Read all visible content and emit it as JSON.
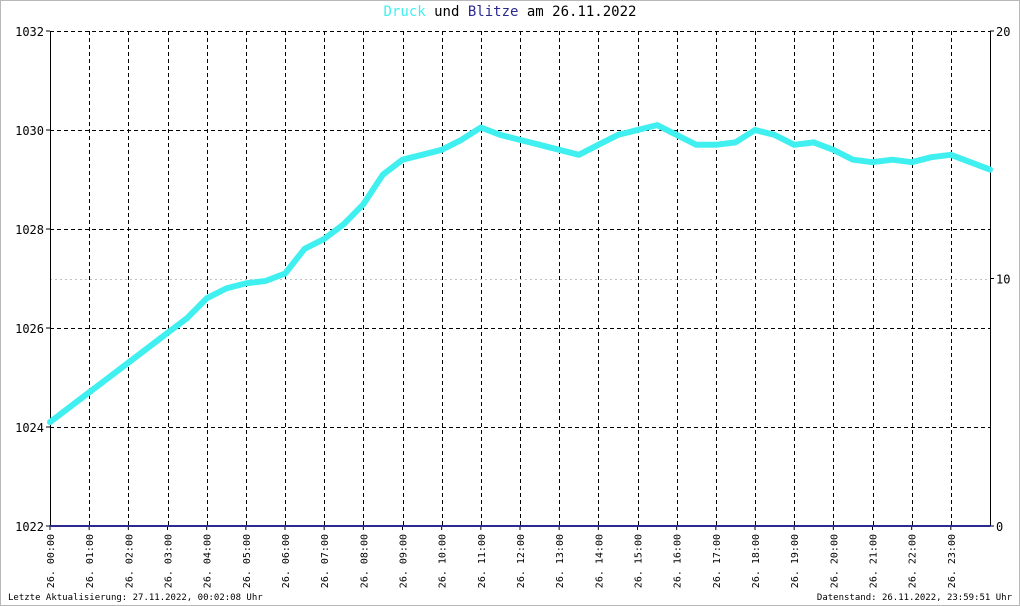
{
  "title": {
    "part1": "Druck",
    "part2": " und ",
    "part3": "Blitze",
    "part4": " am 26.11.2022"
  },
  "colors": {
    "pressure": "#40f0f0",
    "lightning": "#2a2a90",
    "grid": "#000000",
    "axis": "#000000",
    "text": "#000000"
  },
  "footer": {
    "left": "Letzte Aktualisierung: 27.11.2022, 00:02:08 Uhr",
    "right": "Datenstand: 26.11.2022, 23:59:51 Uhr"
  },
  "chart_data": {
    "type": "line",
    "title": "Druck und Blitze am 26.11.2022",
    "x_tick_labels": [
      "26. 00:00",
      "26. 01:00",
      "26. 02:00",
      "26. 03:00",
      "26. 04:00",
      "26. 05:00",
      "26. 06:00",
      "26. 07:00",
      "26. 08:00",
      "26. 09:00",
      "26. 10:00",
      "26. 11:00",
      "26. 12:00",
      "26. 13:00",
      "26. 14:00",
      "26. 15:00",
      "26. 16:00",
      "26. 17:00",
      "26. 18:00",
      "26. 19:00",
      "26. 20:00",
      "26. 21:00",
      "26. 22:00",
      "26. 23:00"
    ],
    "xlim": [
      0,
      24
    ],
    "y_left": {
      "range": [
        1022,
        1032
      ],
      "ticks": [
        1022,
        1024,
        1026,
        1028,
        1030,
        1032
      ]
    },
    "y_right": {
      "range": [
        0,
        20
      ],
      "ticks": [
        0,
        10,
        20
      ]
    },
    "grid": true,
    "series": [
      {
        "name": "Druck",
        "axis": "left",
        "x": [
          0,
          0.5,
          1,
          1.5,
          2,
          2.5,
          3,
          3.5,
          4,
          4.5,
          5,
          5.5,
          6,
          6.5,
          7,
          7.5,
          8,
          8.5,
          9,
          9.5,
          10,
          10.5,
          11,
          11.5,
          12,
          12.5,
          13,
          13.5,
          14,
          14.5,
          15,
          15.5,
          16,
          16.5,
          17,
          17.5,
          18,
          18.5,
          19,
          19.5,
          20,
          20.5,
          21,
          21.5,
          22,
          22.5,
          23,
          23.5,
          24
        ],
        "values": [
          1024.1,
          1024.4,
          1024.7,
          1025.0,
          1025.3,
          1025.6,
          1025.9,
          1026.2,
          1026.6,
          1026.8,
          1026.9,
          1026.95,
          1027.1,
          1027.6,
          1027.8,
          1028.1,
          1028.5,
          1029.1,
          1029.4,
          1029.5,
          1029.6,
          1029.8,
          1030.05,
          1029.9,
          1029.8,
          1029.7,
          1029.6,
          1029.5,
          1029.7,
          1029.9,
          1030.0,
          1030.1,
          1029.9,
          1029.7,
          1029.7,
          1029.75,
          1030.0,
          1029.9,
          1029.7,
          1029.75,
          1029.6,
          1029.4,
          1029.35,
          1029.4,
          1029.35,
          1029.45,
          1029.5,
          1029.35,
          1029.2
        ]
      },
      {
        "name": "Blitze",
        "axis": "right",
        "x": [
          0,
          24
        ],
        "values": [
          0,
          0
        ]
      }
    ]
  }
}
